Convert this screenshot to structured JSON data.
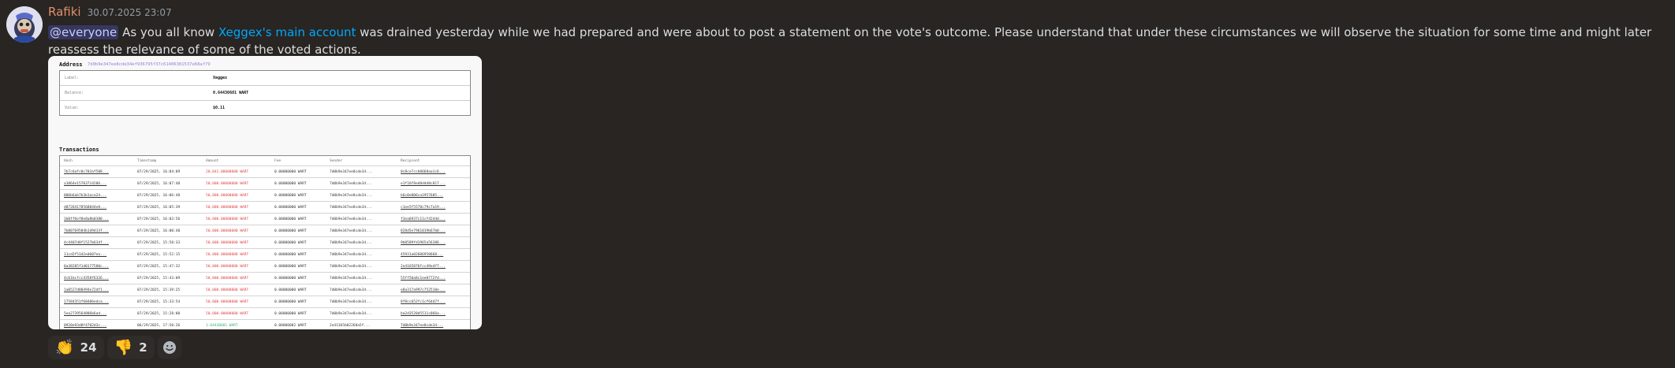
{
  "message": {
    "username": "Rafiki",
    "timestamp": "30.07.2025 23:07",
    "mention": "@everyone",
    "text_before_link": " As you all know ",
    "link_text": "Xeggex's main account",
    "text_after_link": " was drained yesterday while we had prepared and were about to post a statement on the vote's outcome. Please understand that under these circumstances we will observe the situation for some time and might later reassess the relevance of some of the voted actions."
  },
  "attachment": {
    "address_title": "Address",
    "address_hash": "7d0b9e347ee8cde34ef936795f37c61406301537e68af79",
    "info": [
      {
        "label": "Label:",
        "value": "Xeggex"
      },
      {
        "label": "Balance:",
        "value": "0.64430681 WART"
      },
      {
        "label": "Value:",
        "value": "$0.11"
      }
    ],
    "transactions_title": "Transactions",
    "columns": [
      "Hash",
      "Timestamp",
      "Amount",
      "Fee",
      "Sender",
      "Recipient"
    ],
    "rows": [
      [
        "7b7c6afc0c703af588...",
        "07/29/2025, 16:04:09",
        "20,041.00000000 WART",
        "0.00000000 WART",
        "7d0b9e347ee8cde34...",
        "0c8ce7ccb0668aa1c6..."
      ],
      [
        "a1064e15703714206...",
        "07/29/2025, 16:07:40",
        "50,000.00000000 WART",
        "0.00000000 WART",
        "7d0b9e347ee8cde34...",
        "e1f16f8ed8d4d8c817..."
      ],
      [
        "006b6ab7b3b1aca24...",
        "07/29/2025, 16:06:48",
        "50,000.00000000 WART",
        "0.00000000 WART",
        "7d0b9e347ee8cde34...",
        "b6c0e806ca1957685..."
      ],
      [
        "d87264178568044e8...",
        "07/29/2025, 16:05:39",
        "50,000.00000000 WART",
        "0.00000000 WART",
        "7d0b9e347ee8cde34...",
        "c1ee5f5578c79c7a19..."
      ],
      [
        "1b0ff6ef8e8a8b0380...",
        "07/29/2025, 16:03:56",
        "50,000.00000000 WART",
        "0.00000000 WART",
        "7d0b9e347ee8cde34...",
        "f3ea6937c11cf4244d..."
      ],
      [
        "7b00769504b1d9433f...",
        "07/29/2025, 16:00:48",
        "50,000.00000000 WART",
        "0.00000000 WART",
        "7d0b9e347ee8cde34...",
        "828d5e7961019b67b0..."
      ],
      [
        "4c4407d0f1527b634f...",
        "07/29/2025, 15:58:33",
        "50,000.00000000 WART",
        "0.00000000 WART",
        "7d0b9e347ee8cde34...",
        "9b0589fd1965a56386..."
      ],
      [
        "11cd2f51d2ed607ea...",
        "07/29/2025, 15:52:15",
        "50,000.00000000 WART",
        "0.00000000 WART",
        "7d0b9e347ee8cde34...",
        "45931a02606958668..."
      ],
      [
        "0a38285f1d0177580c...",
        "07/29/2025, 15:47:32",
        "50,000.00000000 WART",
        "0.00000000 WART",
        "7d0b9e347ee8cde34...",
        "2e4165876fcc49e4f7..."
      ],
      [
        "4c61bcfcc4358f6326...",
        "07/29/2025, 15:43:09",
        "50,000.00000000 WART",
        "0.00000000 WART",
        "7d0b9e347ee8cde34...",
        "55ff50a8c1ee8772fd..."
      ],
      [
        "1a0527d80494e72df1...",
        "07/29/2025, 15:39:25",
        "50,000.00000000 WART",
        "0.00000000 WART",
        "7d0b9e347ee8cde34...",
        "e8a317a997c752510e..."
      ],
      [
        "17584351f60406edca...",
        "07/29/2025, 15:33:54",
        "50,000.00000000 WART",
        "0.00000000 WART",
        "7d0b9e347ee8cde34...",
        "8f8cc652fc1cf64d7f..."
      ],
      [
        "5ea2739564806b6ad...",
        "07/29/2025, 15:28:00",
        "50,000.00000000 WART",
        "0.00000000 WART",
        "7d0b9e347ee8cde34...",
        "ba2d3520d5511c066a..."
      ],
      [
        "0920e93d8f4702d3c...",
        "06/29/2025, 17:50:26",
        "1.64430681 WART",
        "0.00000002 WART",
        "2e41365b02268a5f...",
        "7d0b9e347ee8cde34..."
      ]
    ]
  },
  "reactions": [
    {
      "emoji": "👏",
      "count": "24",
      "emoji_name": "clap-emoji"
    },
    {
      "emoji": "👎",
      "count": "2",
      "emoji_name": "thumbs-down-emoji"
    }
  ],
  "colors": {
    "username": "#e2906a",
    "link": "#00a8fc",
    "mention_bg": "#5865f24d",
    "negative_amount": "#e04545",
    "positive_amount": "#2fb36b"
  }
}
